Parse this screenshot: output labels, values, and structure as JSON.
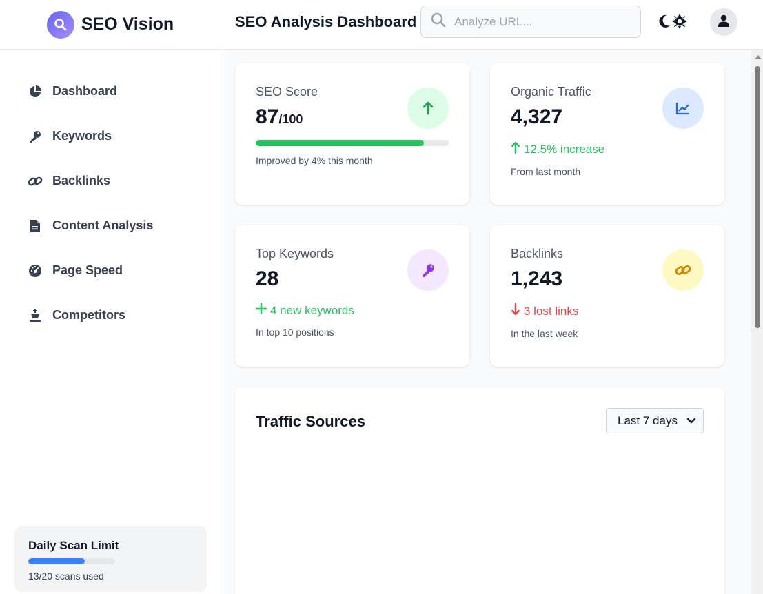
{
  "brand": {
    "name": "SEO Vision"
  },
  "sidebar": {
    "items": [
      {
        "label": "Dashboard",
        "icon": "pie-chart-icon"
      },
      {
        "label": "Keywords",
        "icon": "key-icon"
      },
      {
        "label": "Backlinks",
        "icon": "link-icon"
      },
      {
        "label": "Content Analysis",
        "icon": "document-icon"
      },
      {
        "label": "Page Speed",
        "icon": "gauge-icon"
      },
      {
        "label": "Competitors",
        "icon": "chess-king-icon"
      }
    ],
    "scan_limit": {
      "title": "Daily Scan Limit",
      "used_text": "13/20 scans used",
      "used": 13,
      "total": 20
    }
  },
  "header": {
    "title": "SEO Analysis Dashboard",
    "search_placeholder": "Analyze URL..."
  },
  "cards": {
    "seo_score": {
      "label": "SEO Score",
      "value": "87",
      "suffix": "/100",
      "progress": 0.87,
      "note": "Improved by 4% this month"
    },
    "organic_traffic": {
      "label": "Organic Traffic",
      "value": "4,327",
      "trend": "12.5% increase",
      "note": "From last month"
    },
    "top_keywords": {
      "label": "Top Keywords",
      "value": "28",
      "trend": "4 new keywords",
      "note": "In top 10 positions"
    },
    "backlinks": {
      "label": "Backlinks",
      "value": "1,243",
      "trend": "3 lost links",
      "note": "In the last week"
    }
  },
  "traffic": {
    "title": "Traffic Sources",
    "range": "Last 7 days"
  },
  "colors": {
    "accent": "#6366f1",
    "success": "#22c55e",
    "danger": "#ef4444",
    "progress_scan": "#3b82f6"
  }
}
